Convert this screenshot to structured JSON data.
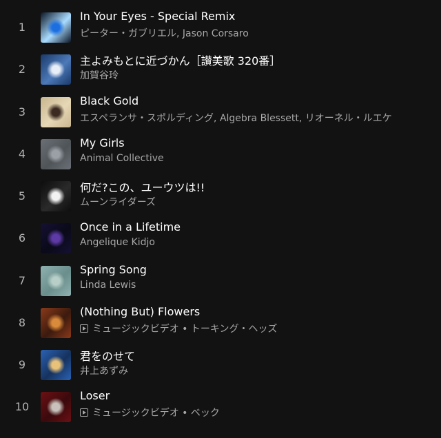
{
  "tracks": [
    {
      "num": "1",
      "title": "In Your Eyes - Special Remix",
      "subtitle": "ピーター・ガブリエル, Jason Corsaro",
      "video": false,
      "colors": [
        "#0b1626",
        "#1d6fe0",
        "#a9dcff"
      ]
    },
    {
      "num": "2",
      "title": "主よみもとに近づかん［讃美歌 320番］",
      "subtitle": "加賀谷玲",
      "video": false,
      "colors": [
        "#1a3a6b",
        "#e8eef7",
        "#4c79b8"
      ]
    },
    {
      "num": "3",
      "title": "Black Gold",
      "subtitle": "エスペランサ・スポルディング, Algebra Blessett, リオーネル・ルエケ",
      "video": false,
      "colors": [
        "#c9b68f",
        "#3a2a20",
        "#e6d7b5"
      ]
    },
    {
      "num": "4",
      "title": "My Girls",
      "subtitle": "Animal Collective",
      "video": false,
      "colors": [
        "#6a7076",
        "#9aa0a6",
        "#4f5458"
      ]
    },
    {
      "num": "5",
      "title": "何だ?この、ユーウツは!!",
      "subtitle": "ムーンライダーズ",
      "video": false,
      "colors": [
        "#0d0d0d",
        "#f2f2f2",
        "#2a2a2a"
      ]
    },
    {
      "num": "6",
      "title": "Once in a Lifetime",
      "subtitle": "Angelique Kidjo",
      "video": false,
      "colors": [
        "#151033",
        "#5d3aa6",
        "#0a0a18"
      ]
    },
    {
      "num": "7",
      "title": "Spring Song",
      "subtitle": "Linda Lewis",
      "video": false,
      "colors": [
        "#8fb2b0",
        "#b7cfc8",
        "#6a8e8b"
      ]
    },
    {
      "num": "8",
      "title": "(Nothing But) Flowers",
      "subtitle": "ミュージックビデオ • トーキング・ヘッズ",
      "video": true,
      "colors": [
        "#8a3a1a",
        "#d98a3a",
        "#3b1a0e"
      ]
    },
    {
      "num": "9",
      "title": "君をのせて",
      "subtitle": "井上あずみ",
      "video": false,
      "colors": [
        "#2a62b3",
        "#e9c27a",
        "#16325e"
      ]
    },
    {
      "num": "10",
      "title": "Loser",
      "subtitle": "ミュージックビデオ • ベック",
      "video": true,
      "colors": [
        "#6b1014",
        "#c9c2bc",
        "#3a0a0c"
      ]
    }
  ]
}
